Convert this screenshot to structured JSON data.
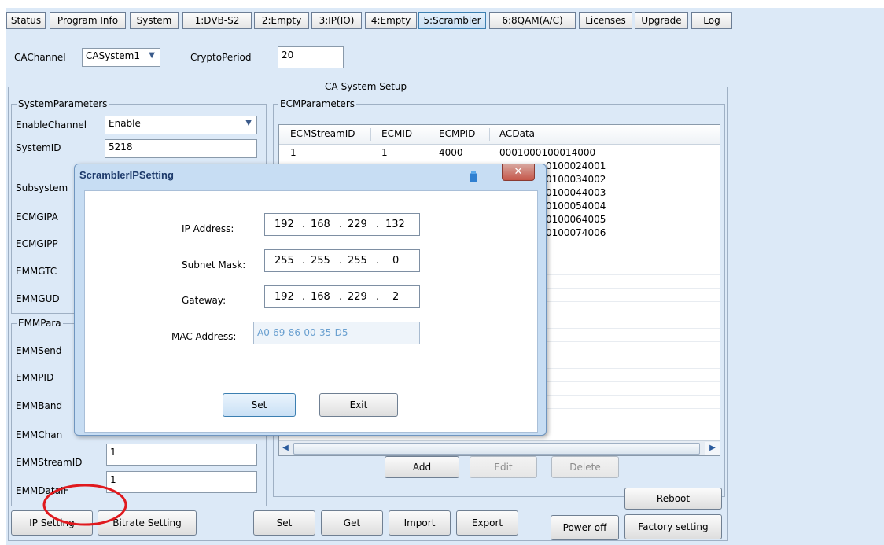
{
  "tabs": [
    "Status",
    "Program Info",
    "System",
    "1:DVB-S2",
    "2:Empty",
    "3:IP(IO)",
    "4:Empty",
    "5:Scrambler",
    "6:8QAM(A/C)",
    "Licenses",
    "Upgrade",
    "Log"
  ],
  "top": {
    "cachannel_label": "CAChannel",
    "cachannel_value": "CASystem1",
    "cryptoperiod_label": "CryptoPeriod",
    "cryptoperiod_value": "20"
  },
  "ca_setup": {
    "title": "CA-System Setup"
  },
  "system_params": {
    "title": "SystemParameters",
    "enable_label": "EnableChannel",
    "enable_value": "Enable",
    "systemid_label": "SystemID",
    "systemid_value": "5218",
    "subsystem_label": "Subsystem",
    "ecmgipa_label": "ECMGIPA",
    "ecmgipp_label": "ECMGIPP",
    "emmgtc_label": "EMMGTC",
    "emmgud_label": "EMMGUD"
  },
  "emm_params": {
    "title": "EMMPara",
    "emmsend_label": "EMMSend",
    "emmpid_label": "EMMPID",
    "emmband_label": "EMMBand",
    "emmchan_label": "EMMChan",
    "emmstreamid_label": "EMMStreamID",
    "emmstreamid_value": "1",
    "emmdataif_label": "EMMDataIF",
    "emmdataif_value": "1"
  },
  "ecm_params": {
    "title": "ECMParameters",
    "columns": [
      "ECMStreamID",
      "ECMID",
      "ECMPID",
      "ACData"
    ],
    "rows": [
      {
        "c0": "1",
        "c1": "1",
        "c2": "4000",
        "c3": "0001000100014000"
      },
      {
        "c3": "0100024001"
      },
      {
        "c3": "0100034002"
      },
      {
        "c3": "0100044003"
      },
      {
        "c3": "0100054004"
      },
      {
        "c3": "0100064005"
      },
      {
        "c3": "0100074006"
      }
    ],
    "add": "Add",
    "edit": "Edit",
    "delete": "Delete"
  },
  "bottom": {
    "ip_setting": "IP Setting",
    "bitrate_setting": "Bitrate Setting",
    "set": "Set",
    "get": "Get",
    "import": "Import",
    "export": "Export",
    "power_off": "Power off",
    "reboot": "Reboot",
    "factory": "Factory setting"
  },
  "dialog": {
    "title": "ScramblerIPSetting",
    "close": "✕",
    "ip_label": "IP Address:",
    "ip": [
      "192",
      "168",
      "229",
      "132"
    ],
    "mask_label": "Subnet Mask:",
    "mask": [
      "255",
      "255",
      "255",
      "0"
    ],
    "gw_label": "Gateway:",
    "gw": [
      "192",
      "168",
      "229",
      "2"
    ],
    "mac_label": "MAC Address:",
    "mac": "A0-69-86-00-35-D5",
    "set": "Set",
    "exit": "Exit"
  },
  "colors": {
    "annotation": "#e0191e",
    "accent": "#3c7fb1",
    "window_bg": "#dce9f7",
    "dialog_frame": "#c7ddf3",
    "disabled_text": "#6aa0d0"
  }
}
